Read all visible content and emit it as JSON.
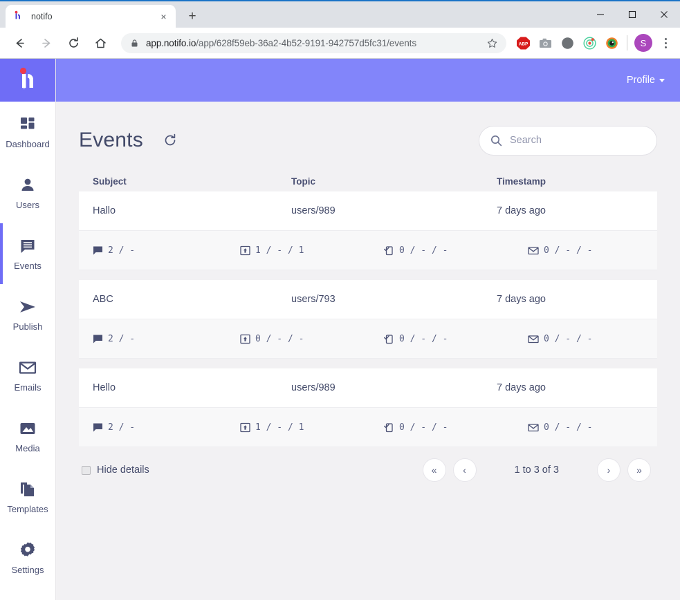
{
  "browser": {
    "tab": {
      "title": "notifo",
      "favicon": "notifo-logo-icon",
      "close": "×"
    },
    "new_tab_label": "+",
    "window_controls": {
      "minimize": "—",
      "maximize": "☐",
      "close": "✕"
    },
    "nav": {
      "back": "←",
      "forward": "→",
      "reload": "↻",
      "home": "⌂"
    },
    "omnibox": {
      "url_bold": "app.notifo.io",
      "url_rest": "/app/628f59eb-36a2-4b52-9191-942757d5fc31/events",
      "lock_icon": "lock-icon",
      "star_icon": "bookmark-star-icon"
    },
    "extensions": [
      {
        "name": "adblock-plus-extension",
        "label": "ABP",
        "color": "#d81c1c"
      },
      {
        "name": "screenshot-camera-extension",
        "label": "",
        "color": "#9aa0a6"
      },
      {
        "name": "dark-mode-extension",
        "label": "",
        "color": "#6e7276"
      },
      {
        "name": "target-tracker-extension",
        "label": "",
        "color": "#4fd2a0"
      },
      {
        "name": "colorzilla-extension",
        "label": "",
        "color": "#f07f2a"
      }
    ],
    "profile_avatar": "S",
    "menu_icon": "kebab-menu-icon"
  },
  "sidebar": {
    "logo": "notifo-logo",
    "items": [
      {
        "label": "Dashboard",
        "icon": "dashboard-grid-icon",
        "active": false
      },
      {
        "label": "Users",
        "icon": "user-icon",
        "active": false
      },
      {
        "label": "Events",
        "icon": "events-message-icon",
        "active": true
      },
      {
        "label": "Publish",
        "icon": "send-arrow-icon",
        "active": false
      },
      {
        "label": "Emails",
        "icon": "envelope-icon",
        "active": false
      },
      {
        "label": "Media",
        "icon": "image-icon",
        "active": false
      },
      {
        "label": "Templates",
        "icon": "templates-copy-icon",
        "active": false
      },
      {
        "label": "Settings",
        "icon": "gear-icon",
        "active": false
      }
    ]
  },
  "topbar": {
    "profile_label": "Profile"
  },
  "page": {
    "title": "Events",
    "refresh_icon": "refresh-icon",
    "search": {
      "placeholder": "Search",
      "value": "",
      "icon": "search-icon"
    }
  },
  "table": {
    "headers": {
      "subject": "Subject",
      "topic": "Topic",
      "timestamp": "Timestamp"
    },
    "rows": [
      {
        "subject": "Hallo",
        "topic": "users/989",
        "timestamp": "7 days ago",
        "stats": [
          {
            "icon": "comment-bubble-icon",
            "value": "2 / -"
          },
          {
            "icon": "web-push-icon",
            "value": "1 / - / 1"
          },
          {
            "icon": "mobile-push-icon",
            "value": "0 / - / -"
          },
          {
            "icon": "email-icon",
            "value": "0 / - / -"
          }
        ]
      },
      {
        "subject": "ABC",
        "topic": "users/793",
        "timestamp": "7 days ago",
        "stats": [
          {
            "icon": "comment-bubble-icon",
            "value": "2 / -"
          },
          {
            "icon": "web-push-icon",
            "value": "0 / - / -"
          },
          {
            "icon": "mobile-push-icon",
            "value": "0 / - / -"
          },
          {
            "icon": "email-icon",
            "value": "0 / - / -"
          }
        ]
      },
      {
        "subject": "Hello",
        "topic": "users/989",
        "timestamp": "7 days ago",
        "stats": [
          {
            "icon": "comment-bubble-icon",
            "value": "2 / -"
          },
          {
            "icon": "web-push-icon",
            "value": "1 / - / 1"
          },
          {
            "icon": "mobile-push-icon",
            "value": "0 / - / -"
          },
          {
            "icon": "email-icon",
            "value": "0 / - / -"
          }
        ]
      }
    ]
  },
  "footer": {
    "hide_details_label": "Hide details",
    "hide_details_checked": false,
    "pagination": {
      "first": "«",
      "prev": "‹",
      "info": "1 to 3 of 3",
      "next": "›",
      "last": "»"
    }
  },
  "colors": {
    "brand_purple": "#6f6df6",
    "topbar_purple": "#8285fa",
    "page_bg": "#f2f1f3",
    "text_navy": "#434a69",
    "detail_row_bg": "#f8f8f9"
  }
}
